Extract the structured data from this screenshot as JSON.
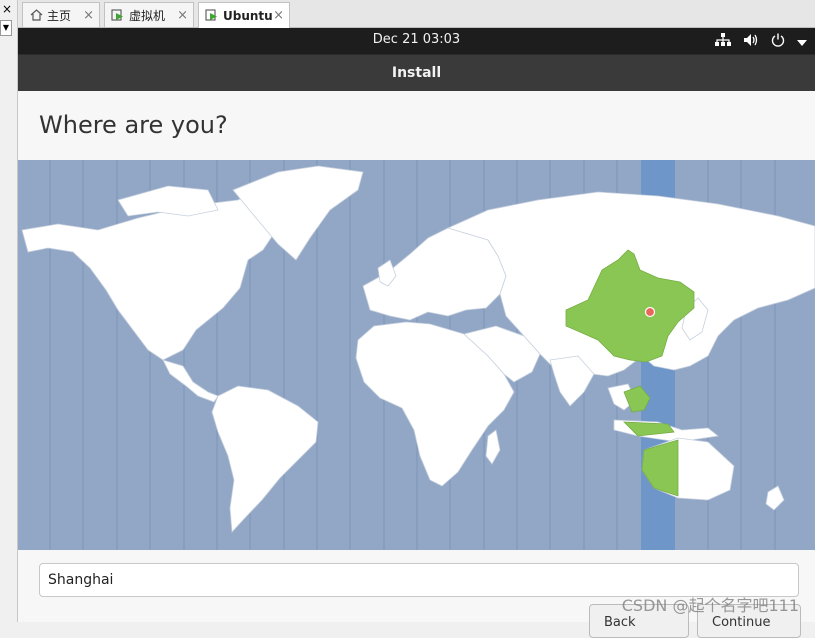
{
  "left_panel": {
    "close_glyph": "×",
    "dropdown_glyph": "▼"
  },
  "tabs": [
    {
      "label": "主页",
      "icon": "home-icon"
    },
    {
      "label": "虚拟机",
      "icon": "vm-icon"
    },
    {
      "label": "Ubuntu",
      "icon": "vm-icon",
      "active": true
    }
  ],
  "tab_close_glyph": "×",
  "topbar": {
    "clock": "Dec 21  03:03",
    "icons": [
      "network-icon",
      "volume-icon",
      "power-icon",
      "menu-arrow-icon"
    ]
  },
  "window": {
    "title": "Install"
  },
  "page": {
    "heading": "Where are you?",
    "location_value": "Shanghai",
    "back_label": "Back",
    "continue_label": "Continue"
  },
  "map": {
    "selected_location": "Shanghai",
    "ocean_color": "#92a7c6",
    "land_color": "#ffffff",
    "highlight_color": "#8ac653",
    "timezone_band_color": "#6f96c9",
    "marker_color": "#e8675a"
  },
  "watermark": "CSDN @起个名字吧111"
}
